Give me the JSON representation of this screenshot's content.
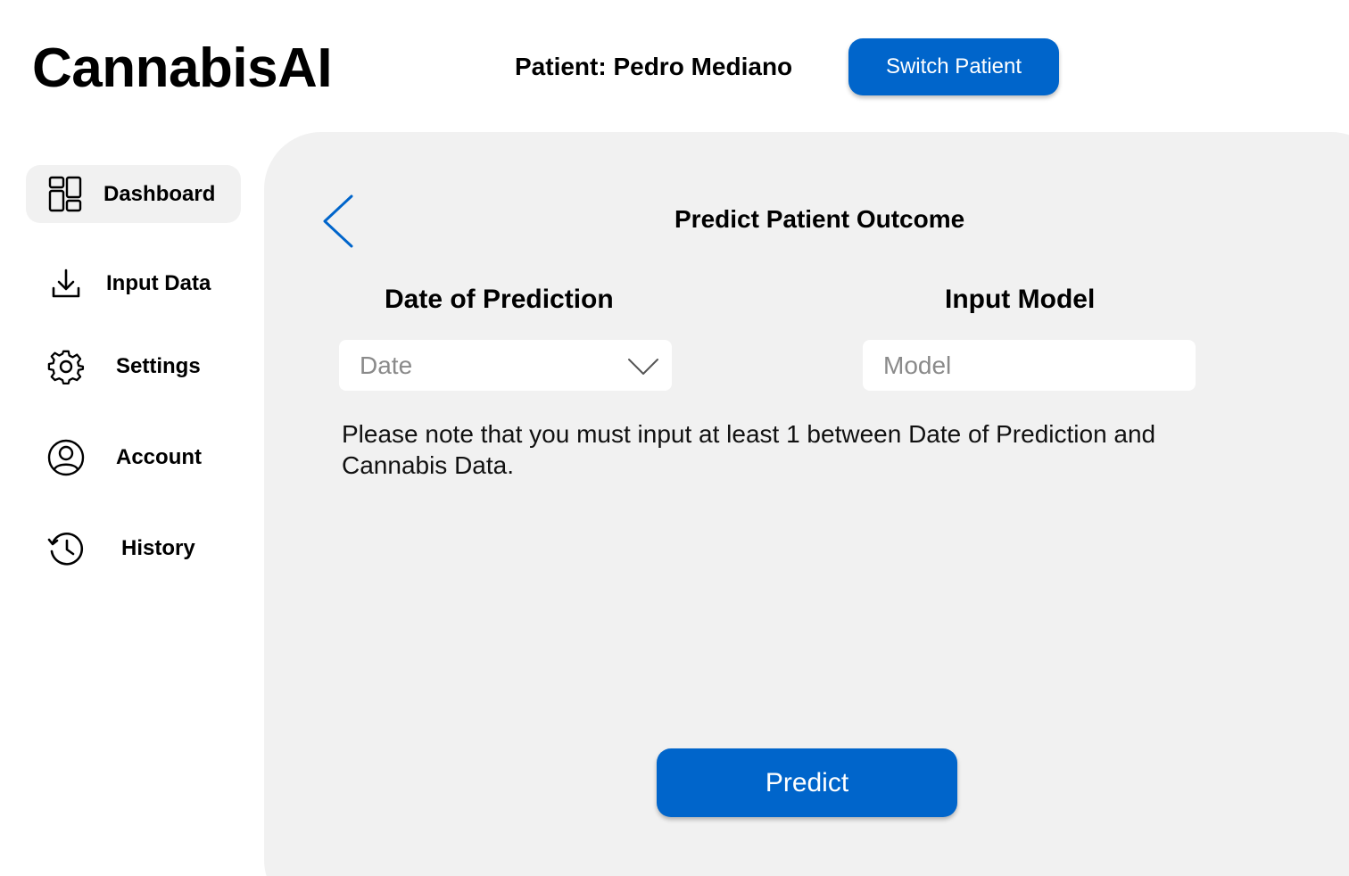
{
  "header": {
    "app_title": "CannabisAI",
    "patient_label": "Patient: Pedro Mediano",
    "switch_patient_label": "Switch Patient"
  },
  "sidebar": {
    "items": [
      {
        "label": "Dashboard",
        "icon": "dashboard-icon",
        "active": true
      },
      {
        "label": "Input Data",
        "icon": "download-icon",
        "active": false
      },
      {
        "label": "Settings",
        "icon": "gear-icon",
        "active": false
      },
      {
        "label": "Account",
        "icon": "user-circle-icon",
        "active": false
      },
      {
        "label": "History",
        "icon": "history-icon",
        "active": false
      }
    ]
  },
  "main": {
    "back_icon": "chevron-left-icon",
    "title": "Predict Patient Outcome",
    "date_field": {
      "heading": "Date of Prediction",
      "placeholder": "Date",
      "icon": "chevron-down-icon"
    },
    "model_field": {
      "heading": "Input Model",
      "placeholder": "Model",
      "value": ""
    },
    "note": "Please note that you must input at least 1 between Date of Prediction and Cannabis Data.",
    "predict_label": "Predict"
  },
  "colors": {
    "accent": "#0065cb",
    "panel_bg": "#f1f1f1",
    "placeholder": "#8a8a8a"
  }
}
